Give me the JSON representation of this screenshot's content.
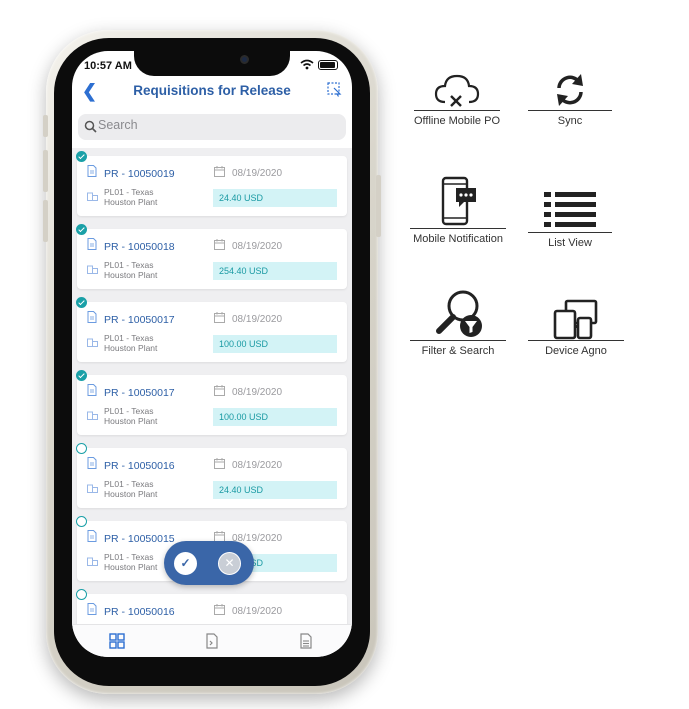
{
  "status": {
    "time": "10:57 AM"
  },
  "nav": {
    "title": "Requisitions for Release",
    "back": "❮"
  },
  "search": {
    "placeholder": "Search"
  },
  "requisitions": [
    {
      "id": "PR - 10050019",
      "date": "08/19/2020",
      "plant_line1": "PL01 - Texas",
      "plant_line2": "Houston Plant",
      "amount": "24.40  USD",
      "selected": true
    },
    {
      "id": "PR - 10050018",
      "date": "08/19/2020",
      "plant_line1": "PL01 - Texas",
      "plant_line2": "Houston Plant",
      "amount": "254.40  USD",
      "selected": true
    },
    {
      "id": "PR - 10050017",
      "date": "08/19/2020",
      "plant_line1": "PL01 - Texas",
      "plant_line2": "Houston Plant",
      "amount": "100.00  USD",
      "selected": true
    },
    {
      "id": "PR - 10050017",
      "date": "08/19/2020",
      "plant_line1": "PL01 - Texas",
      "plant_line2": "Houston Plant",
      "amount": "100.00  USD",
      "selected": true
    },
    {
      "id": "PR - 10050016",
      "date": "08/19/2020",
      "plant_line1": "PL01 - Texas",
      "plant_line2": "Houston Plant",
      "amount": "24.40  USD",
      "selected": false
    },
    {
      "id": "PR - 10050015",
      "date": "08/19/2020",
      "plant_line1": "PL01 - Texas",
      "plant_line2": "Houston Plant",
      "amount": "24.40  USD",
      "selected": false
    },
    {
      "id": "PR - 10050016",
      "date": "08/19/2020",
      "plant_line1": "",
      "plant_line2": "",
      "amount": "",
      "selected": false
    }
  ],
  "fab": {
    "approve": "✓",
    "reject": "✕"
  },
  "tabs": [
    {
      "icon": "grid-icon"
    },
    {
      "icon": "code-document-icon"
    },
    {
      "icon": "document-list-icon"
    }
  ],
  "features": [
    {
      "label": "Offline Mobile PO",
      "icon": "cloud-offline-icon"
    },
    {
      "label": "Sync",
      "icon": "sync-icon"
    },
    {
      "label": "Mobile Notification",
      "icon": "mobile-notification-icon"
    },
    {
      "label": "List View",
      "icon": "list-view-icon"
    },
    {
      "label": "Filter & Search",
      "icon": "filter-search-icon"
    },
    {
      "label": "Device Agno",
      "icon": "devices-icon"
    }
  ],
  "colors": {
    "primary": "#2d5fa6",
    "accent_teal": "#1aa0a7",
    "amount_bg": "#d3f3f6",
    "fab": "#3a66a8"
  }
}
